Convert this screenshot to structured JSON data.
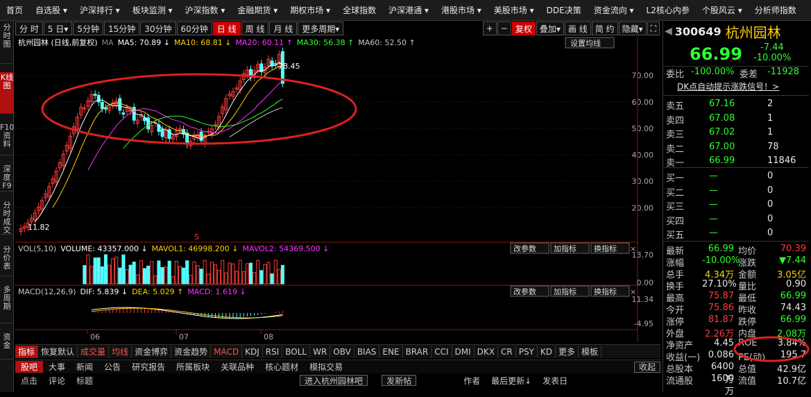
{
  "menu": [
    "首页",
    "自选股 ▾",
    "沪深排行 ▾",
    "板块监测 ▾",
    "沪深指数 ▾",
    "金融期货 ▾",
    "期权市场 ▾",
    "全球指数",
    "沪深港通 ▾",
    "港股市场 ▾",
    "美股市场 ▾",
    "DDE决策",
    "资金流向 ▾",
    "L2核心内参",
    "个股风云 ▾",
    "分析师指数"
  ],
  "left_tabs": [
    "分时图",
    "K线图",
    "F10资料",
    "深度F9",
    "分时成交",
    "分价表",
    "多周期",
    "资金"
  ],
  "periods": [
    "分 时",
    "5 日▾",
    "5分钟",
    "15分钟",
    "30分钟",
    "60分钟",
    "日 线",
    "周 线",
    "月 线",
    "更多周期▾"
  ],
  "active_period": "日 线",
  "right_tools": [
    "+",
    "−",
    "复权",
    "叠加▾",
    "画 线",
    "简 约",
    "隐藏▾",
    "⛶"
  ],
  "chart_title": "杭州园林 (日线,前复权)",
  "ma_label": "MA",
  "ma_items": [
    {
      "text": "MA5: 70.89 ↓",
      "color": "#ffffff"
    },
    {
      "text": "MA10: 68.81 ↓",
      "color": "#ffd200"
    },
    {
      "text": "MA20: 60.11 ↑",
      "color": "#ff33ff"
    },
    {
      "text": "MA30: 56.38 ↑",
      "color": "#33ff33"
    },
    {
      "text": "MA60: 52.50 ↑",
      "color": "#c8c8c8"
    }
  ],
  "settings_btn": "设置均线",
  "max_label": "78.45",
  "min_label": "11.82",
  "s_marker": "S",
  "vol_legend": [
    {
      "text": "VOL(5,10)",
      "color": "#c8c8c8"
    },
    {
      "text": "VOLUME: 43357.000 ↓",
      "color": "#ffffff"
    },
    {
      "text": "MAVOL1: 46998.200 ↓",
      "color": "#ffd200"
    },
    {
      "text": "MAVOL2: 54369.500 ↓",
      "color": "#ff33ff"
    }
  ],
  "macd_legend": [
    {
      "text": "MACD(12,26,9)",
      "color": "#c8c8c8"
    },
    {
      "text": "DIF: 5.839 ↓",
      "color": "#ffffff"
    },
    {
      "text": "DEA: 5.029 ↑",
      "color": "#ffd200"
    },
    {
      "text": "MACD: 1.619 ↓",
      "color": "#ff33ff"
    }
  ],
  "sub_btns": [
    "改参数",
    "加指标",
    "换指标"
  ],
  "price_axis": [
    "70.00",
    "60.00",
    "50.00",
    "40.00",
    "30.00",
    "20.00"
  ],
  "vol_axis": [
    "13.70",
    "0.00"
  ],
  "macd_axis": [
    "11.34",
    "-4.95"
  ],
  "dates": [
    "06",
    "07",
    "08"
  ],
  "bottom_tabs": [
    "指标",
    "恢复默认",
    "成交量",
    "均线",
    "资金博弈",
    "资金趋势",
    "MACD",
    "KDJ",
    "RSI",
    "BOLL",
    "WR",
    "OBV",
    "BIAS",
    "ENE",
    "BRAR",
    "CCI",
    "DMI",
    "DKX",
    "CR",
    "PSY",
    "KD",
    "更多",
    "模板"
  ],
  "news_tabs": [
    "股吧",
    "大事",
    "新闻",
    "公告",
    "研究报告",
    "所属板块",
    "关联品种",
    "核心题材",
    "模拟交易"
  ],
  "collapse": "收起",
  "news_cols": [
    "点击",
    "评论",
    "标题"
  ],
  "news_btns": [
    "进入杭州园林吧",
    "发新帖"
  ],
  "news_right": [
    "作者",
    "最后更新↓",
    "发表日"
  ],
  "stock": {
    "code": "300649",
    "name": "杭州园林",
    "price": "66.99",
    "change": "-7.44",
    "pct": "-10.00%"
  },
  "weibi": {
    "l1": "委比",
    "v1": "-100.00%",
    "l2": "委差",
    "v2": "-11928"
  },
  "dk_link": "DK点自动提示涨跌信号！>",
  "asks": [
    [
      "卖五",
      "67.16",
      "2"
    ],
    [
      "卖四",
      "67.08",
      "1"
    ],
    [
      "卖三",
      "67.02",
      "1"
    ],
    [
      "卖二",
      "67.00",
      "78"
    ],
    [
      "卖一",
      "66.99",
      "11846"
    ]
  ],
  "bids": [
    [
      "买一",
      "—",
      "0"
    ],
    [
      "买二",
      "—",
      "0"
    ],
    [
      "买三",
      "—",
      "0"
    ],
    [
      "买四",
      "—",
      "0"
    ],
    [
      "买五",
      "—",
      "0"
    ]
  ],
  "stats": [
    [
      "最新",
      "66.99",
      "均价",
      "70.39"
    ],
    [
      "涨幅",
      "-10.00%",
      "涨跌",
      "▼7.44"
    ],
    [
      "总手",
      "4.34万",
      "金额",
      "3.05亿"
    ],
    [
      "换手",
      "27.10%",
      "量比",
      "0.90"
    ],
    [
      "最高",
      "75.87",
      "最低",
      "66.99"
    ],
    [
      "今开",
      "75.86",
      "昨收",
      "74.43"
    ],
    [
      "涨停",
      "81.87",
      "跌停",
      "66.99"
    ],
    [
      "外盘",
      "2.26万",
      "内盘",
      "2.08万"
    ],
    [
      "净资产",
      "4.45",
      "ROE",
      "3.84%"
    ],
    [
      "收益(一)",
      "0.086",
      "PE(动)",
      "195.7"
    ],
    [
      "总股本",
      "6400万",
      "总值",
      "42.9亿"
    ],
    [
      "流通股",
      "1600万",
      "流值",
      "10.7亿"
    ]
  ]
}
